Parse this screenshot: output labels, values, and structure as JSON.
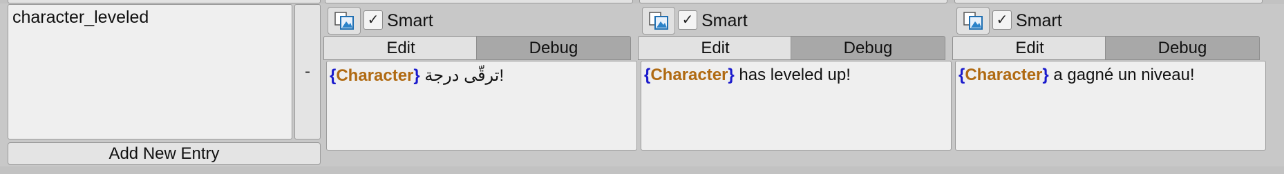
{
  "entry": {
    "key": "character_leveled",
    "remove_label": "-"
  },
  "columns": [
    {
      "icon": "table-icon",
      "smart_checked": true,
      "smart_label": "Smart",
      "tabs": {
        "edit": "Edit",
        "debug": "Debug"
      },
      "text": {
        "open": "{",
        "variable": "Character",
        "close": "}",
        "rest": " ترقّى درجة!"
      }
    },
    {
      "icon": "table-icon",
      "smart_checked": true,
      "smart_label": "Smart",
      "tabs": {
        "edit": "Edit",
        "debug": "Debug"
      },
      "text": {
        "open": "{",
        "variable": "Character",
        "close": "}",
        "rest": " has leveled up!"
      }
    },
    {
      "icon": "table-icon",
      "smart_checked": true,
      "smart_label": "Smart",
      "tabs": {
        "edit": "Edit",
        "debug": "Debug"
      },
      "text": {
        "open": "{",
        "variable": "Character",
        "close": "}",
        "rest": " a gagné un niveau!"
      }
    }
  ],
  "add_button_label": "Add New Entry",
  "check_glyph": "✓",
  "colors": {
    "brace": "#1a1acc",
    "variable": "#b06a12",
    "tab_debug": "#a8a8a8",
    "tab_edit": "#e2e2e2"
  }
}
